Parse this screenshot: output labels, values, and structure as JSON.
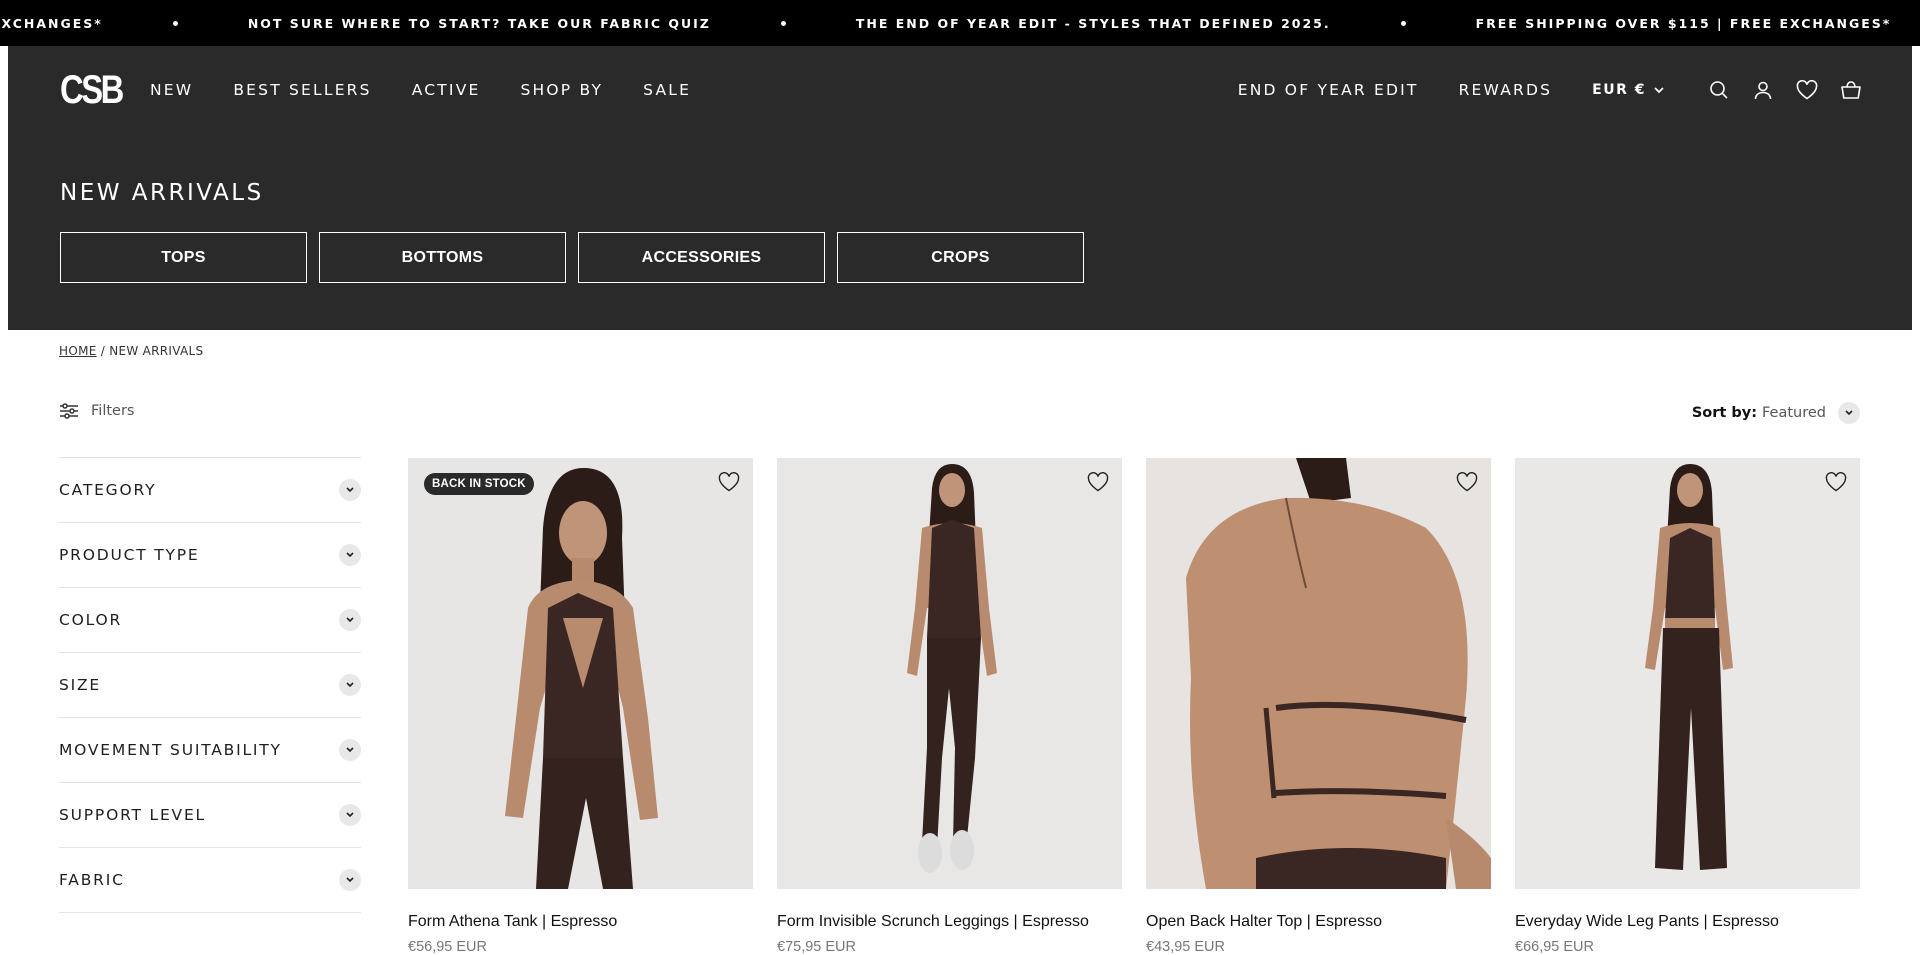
{
  "announcement": {
    "messages": [
      "EXCHANGES*",
      "NOT SURE WHERE TO START? TAKE OUR FABRIC QUIZ",
      "THE END OF YEAR EDIT - STYLES THAT DEFINED 2025.",
      "FREE SHIPPING OVER $115 | FREE EXCHANGES*"
    ]
  },
  "header": {
    "logo": "CSB",
    "nav_left": [
      "NEW",
      "BEST SELLERS",
      "ACTIVE",
      "SHOP BY",
      "SALE"
    ],
    "nav_right": [
      "END OF YEAR EDIT",
      "REWARDS"
    ],
    "currency": "EUR €",
    "icons": [
      "search-icon",
      "account-icon",
      "wishlist-icon",
      "cart-icon"
    ]
  },
  "collection": {
    "title": "NEW ARRIVALS",
    "category_buttons": [
      "TOPS",
      "BOTTOMS",
      "ACCESSORIES",
      "CROPS"
    ]
  },
  "breadcrumb": {
    "home": "HOME",
    "separator": "/",
    "current": "NEW ARRIVALS"
  },
  "toolbar": {
    "filters_label": "Filters",
    "sort_label": "Sort by:",
    "sort_value": "Featured"
  },
  "facets": [
    "CATEGORY",
    "PRODUCT TYPE",
    "COLOR",
    "SIZE",
    "MOVEMENT SUITABILITY",
    "SUPPORT LEVEL",
    "FABRIC"
  ],
  "products": [
    {
      "title": "Form Athena Tank | Espresso",
      "price": "€56,95 EUR",
      "badge": "BACK IN STOCK"
    },
    {
      "title": "Form Invisible Scrunch Leggings | Espresso",
      "price": "€75,95 EUR",
      "badge": ""
    },
    {
      "title": "Open Back Halter Top | Espresso",
      "price": "€43,95 EUR",
      "badge": ""
    },
    {
      "title": "Everyday Wide Leg Pants | Espresso",
      "price": "€66,95 EUR",
      "badge": ""
    }
  ],
  "colors": {
    "announcement_bg": "#000000",
    "header_bg": "#2a2a2a",
    "garment": "#3a2622",
    "skin": "#b98b6e",
    "photo_bg": "#e7e6e5"
  }
}
